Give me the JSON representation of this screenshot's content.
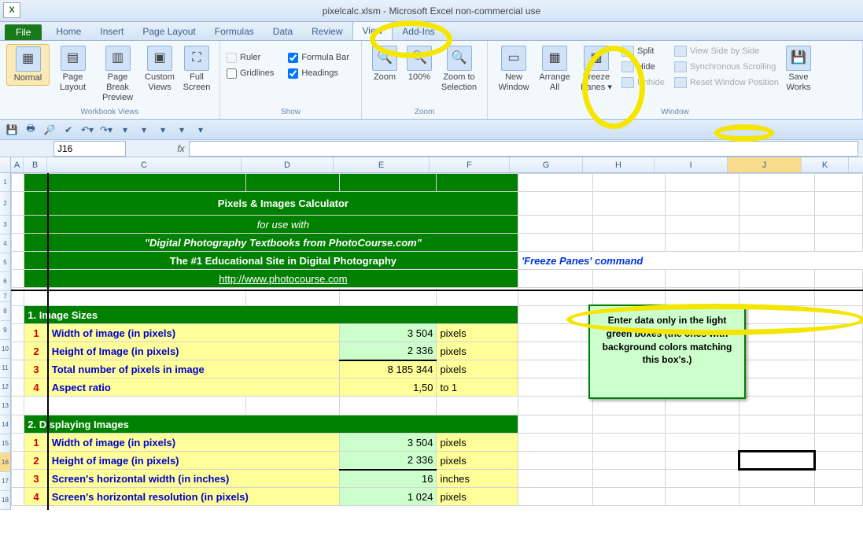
{
  "window": {
    "title": "pixelcalc.xlsm  -  Microsoft Excel non-commercial use"
  },
  "tabs": {
    "file": "File",
    "home": "Home",
    "insert": "Insert",
    "page_layout": "Page Layout",
    "formulas": "Formulas",
    "data": "Data",
    "review": "Review",
    "view": "View",
    "addins": "Add-Ins"
  },
  "ribbon": {
    "workbook_views": {
      "normal": "Normal",
      "page_layout": "Page Layout",
      "page_break": "Page Break Preview",
      "custom": "Custom Views",
      "full": "Full Screen",
      "group": "Workbook Views"
    },
    "show": {
      "ruler": "Ruler",
      "formula_bar": "Formula Bar",
      "gridlines": "Gridlines",
      "headings": "Headings",
      "group": "Show"
    },
    "zoom": {
      "zoom": "Zoom",
      "hundred": "100%",
      "selection": "Zoom to Selection",
      "group": "Zoom"
    },
    "window": {
      "new": "New Window",
      "arrange": "Arrange All",
      "freeze": "Freeze Panes ▾",
      "split": "Split",
      "hide": "Hide",
      "unhide": "Unhide",
      "side": "View Side by Side",
      "sync": "Synchronous Scrolling",
      "reset": "Reset Window Position",
      "save_ws": "Save Workspace",
      "group": "Window"
    }
  },
  "name_box": "J16",
  "columns": [
    "A",
    "B",
    "C",
    "D",
    "E",
    "F",
    "G",
    "H",
    "I",
    "J",
    "K"
  ],
  "rows": [
    "1",
    "2",
    "3",
    "4",
    "5",
    "6",
    "7",
    "8",
    "9",
    "10",
    "11",
    "12",
    "13",
    "14",
    "15",
    "16",
    "17",
    "18"
  ],
  "calc": {
    "title": "Pixels & Images Calculator",
    "sub1": "for use with",
    "sub2": "\"Digital Photography Textbooks from PhotoCourse.com\"",
    "sub3": "The #1 Educational Site in Digital Photography",
    "link": "http://www.photocourse.com"
  },
  "sections": {
    "s1": {
      "header": "1. Image Sizes",
      "r1": {
        "n": "1",
        "label": "Width of image (in pixels)",
        "val": "3 504",
        "unit": "pixels"
      },
      "r2": {
        "n": "2",
        "label": "Height of Image (in pixels)",
        "val": "2 336",
        "unit": "pixels"
      },
      "r3": {
        "n": "3",
        "label": "Total number of pixels in image",
        "val": "8 185 344",
        "unit": "pixels"
      },
      "r4": {
        "n": "4",
        "label": "Aspect ratio",
        "val": "1,50",
        "unit": "to 1"
      }
    },
    "s2": {
      "header": "2. Displaying Images",
      "r1": {
        "n": "1",
        "label": "Width of image (in pixels)",
        "val": "3 504",
        "unit": "pixels"
      },
      "r2": {
        "n": "2",
        "label": "Height of image (in pixels)",
        "val": "2 336",
        "unit": "pixels"
      },
      "r3": {
        "n": "3",
        "label": "Screen's horizontal width (in inches)",
        "val": "16",
        "unit": "inches"
      },
      "r4": {
        "n": "4",
        "label": "Screen's horizontal resolution (in pixels)",
        "val": "1 024",
        "unit": "pixels"
      }
    }
  },
  "annotation": "'Freeze Panes' command",
  "info_box": "Enter data only in the light green boxes (the ones with background colors matching this box's.)"
}
